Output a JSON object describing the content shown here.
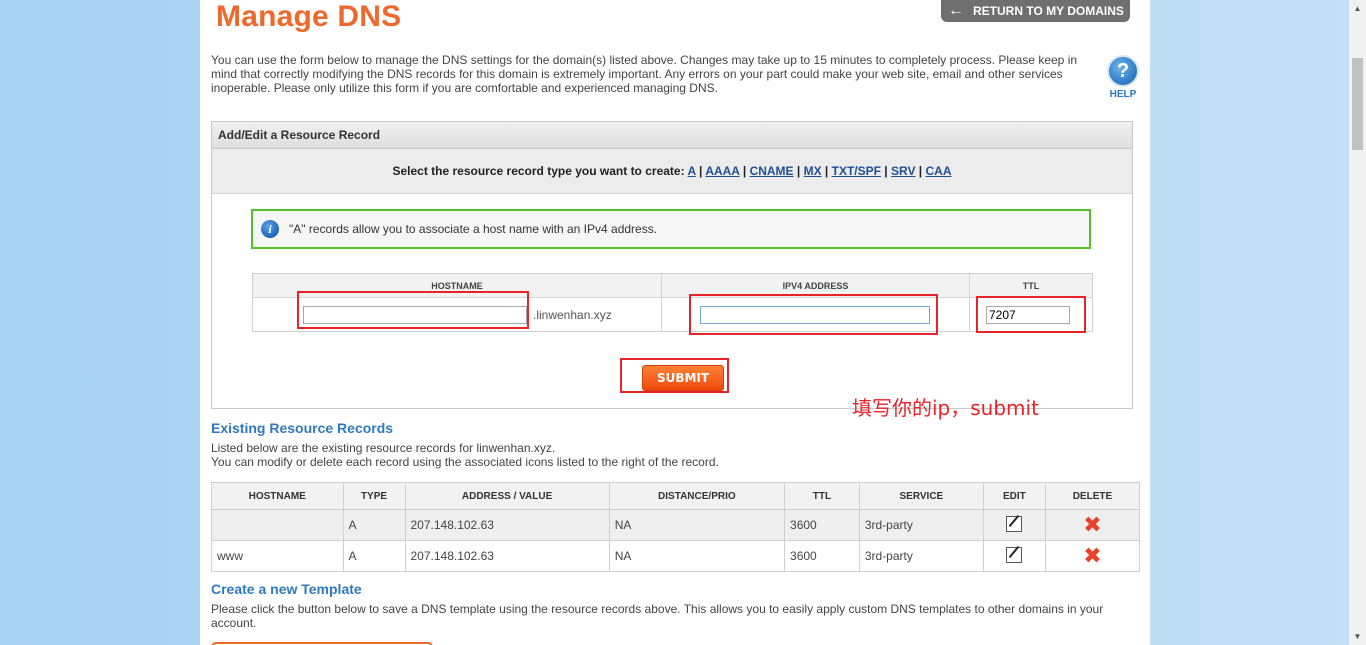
{
  "page": {
    "title": "Manage DNS",
    "return_label": "RETURN TO MY DOMAINS",
    "intro": "You can use the form below to manage the DNS settings for the domain(s) listed above. Changes may take up to 15 minutes to completely process. Please keep in mind that correctly modifying the DNS records for this domain is extremely important. Any errors on your part could make your web site, email and other services inoperable. Please only utilize this form if you are comfortable and experienced managing DNS.",
    "help_label": "HELP",
    "help_glyph": "?"
  },
  "add_edit": {
    "header": "Add/Edit a Resource Record",
    "select_prompt": "Select the resource record type you want to create:",
    "record_types": [
      "A",
      "AAAA",
      "CNAME",
      "MX",
      "TXT/SPF",
      "SRV",
      "CAA"
    ],
    "info_text": "\"A\" records allow you to associate a host name with an IPv4 address.",
    "form": {
      "col_hostname": "HOSTNAME",
      "col_ipv4": "IPV4 ADDRESS",
      "col_ttl": "TTL",
      "hostname_value": "",
      "domain_suffix": ".linwenhan.xyz",
      "ipv4_value": "",
      "ttl_value": "7207"
    },
    "submit_label": "SUBMIT"
  },
  "annotation": "填写你的ip，submit",
  "existing": {
    "title": "Existing Resource Records",
    "line1": "Listed below are the existing resource records for linwenhan.xyz.",
    "line2": "You can modify or delete each record using the associated icons listed to the right of the record.",
    "columns": [
      "HOSTNAME",
      "TYPE",
      "ADDRESS / VALUE",
      "DISTANCE/PRIO",
      "TTL",
      "SERVICE",
      "EDIT",
      "DELETE"
    ],
    "rows": [
      {
        "hostname": "",
        "type": "A",
        "address": "207.148.102.63",
        "prio": "NA",
        "ttl": "3600",
        "service": "3rd-party"
      },
      {
        "hostname": "www",
        "type": "A",
        "address": "207.148.102.63",
        "prio": "NA",
        "ttl": "3600",
        "service": "3rd-party"
      }
    ],
    "delete_glyph": "✖"
  },
  "template": {
    "title": "Create a new Template",
    "text": "Please click the button below to save a DNS template using the resource records above. This allows you to easily apply custom DNS templates to other domains in your account."
  },
  "icons": {
    "return": "arrow-left-icon",
    "help": "question-icon",
    "info": "info-icon",
    "edit": "edit-icon",
    "delete": "delete-icon"
  },
  "colors": {
    "accent_orange": "#ee6a2c",
    "link_blue": "#2f79c0",
    "highlight_red": "#e8232a",
    "info_border_green": "#55c12a"
  }
}
